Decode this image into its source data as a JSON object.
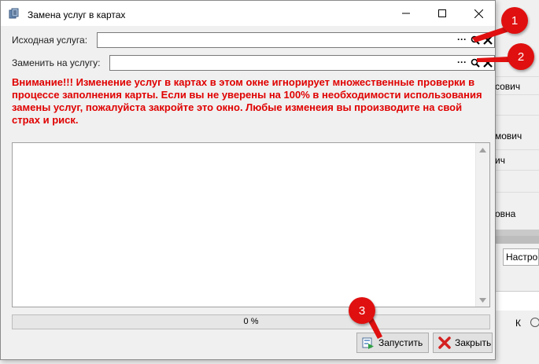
{
  "background": {
    "rows": [
      "сович",
      "мович",
      "ич",
      "овна"
    ],
    "combo_value": "Настрои",
    "col_letter": "К",
    "left_numbers": [
      "1",
      "2"
    ]
  },
  "window": {
    "title": "Замена услуг в картах",
    "minimize_glyph": "—",
    "maximize_glyph": "☐",
    "close_glyph": "✕"
  },
  "form": {
    "source_label": "Исходная услуга:",
    "source_value": "",
    "target_label": "Заменить на услугу:",
    "target_value": "",
    "lookup_dots": "···",
    "warning": "Внимание!!! Изменение услуг в картах в этом окне игнорирует множественные проверки в процессе заполнения карты. Если вы не уверены на 100% в необходимости использования замены услуг, пожалуйста закройте это окно. Любые изменеия вы производите на свой страх и риск.",
    "log_text": ""
  },
  "progress": {
    "value": 0,
    "text": "0 %"
  },
  "buttons": {
    "run_label": "Запустить",
    "close_label": "Закрыть"
  },
  "markers": [
    "1",
    "2",
    "3"
  ],
  "colors": {
    "warning": "#e00000",
    "marker": "#e01010"
  }
}
